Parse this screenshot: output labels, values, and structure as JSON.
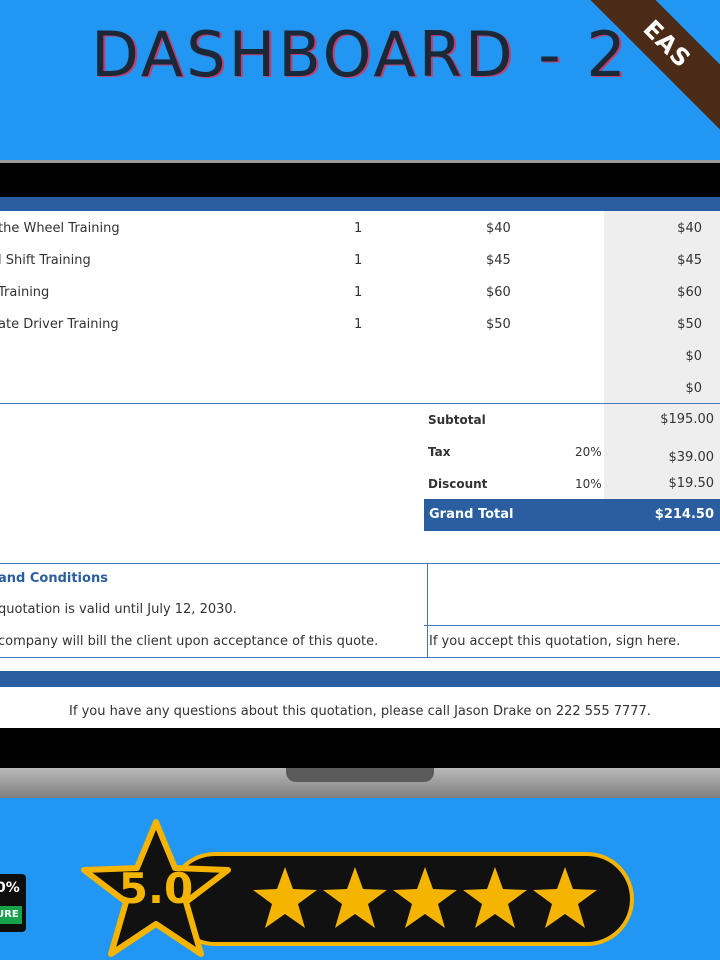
{
  "header": {
    "title": "DASHBOARD - 2",
    "corner_ribbon": "EAS"
  },
  "quote": {
    "items": [
      {
        "item": "the Wheel Training",
        "qty": "1",
        "rate": "$40",
        "total": "$40"
      },
      {
        "item": "l Shift Training",
        "qty": "1",
        "rate": "$45",
        "total": "$45"
      },
      {
        "item": "Training",
        "qty": "1",
        "rate": "$60",
        "total": "$60"
      },
      {
        "item": "ate Driver Training",
        "qty": "1",
        "rate": "$50",
        "total": "$50"
      },
      {
        "item": "",
        "qty": "",
        "rate": "",
        "total": "$0"
      },
      {
        "item": "",
        "qty": "",
        "rate": "",
        "total": "$0"
      }
    ],
    "summary": {
      "subtotal_label": "Subtotal",
      "subtotal_value": "$195.00",
      "tax_label": "Tax",
      "tax_pct": "20%",
      "tax_value": "$39.00",
      "discount_label": "Discount",
      "discount_pct": "10%",
      "discount_value": "$19.50",
      "grand_label": "Grand Total",
      "grand_value": "$214.50"
    },
    "terms": {
      "title": "and Conditions",
      "line1": "quotation is valid until July 12, 2030.",
      "line2": "company will bill the client upon  acceptance of this quote."
    },
    "signature_prompt": "If you accept this quotation, sign here.",
    "footer": "If you have any questions about this quotation, please call Jason Drake on 222 555 7777."
  },
  "badge": {
    "percent": "0%",
    "label": "URE"
  },
  "rating": {
    "score": "5.0",
    "stars": 5
  },
  "colors": {
    "background": "#2196f3",
    "accent_blue": "#2a5ea0",
    "star": "#f5b400"
  }
}
